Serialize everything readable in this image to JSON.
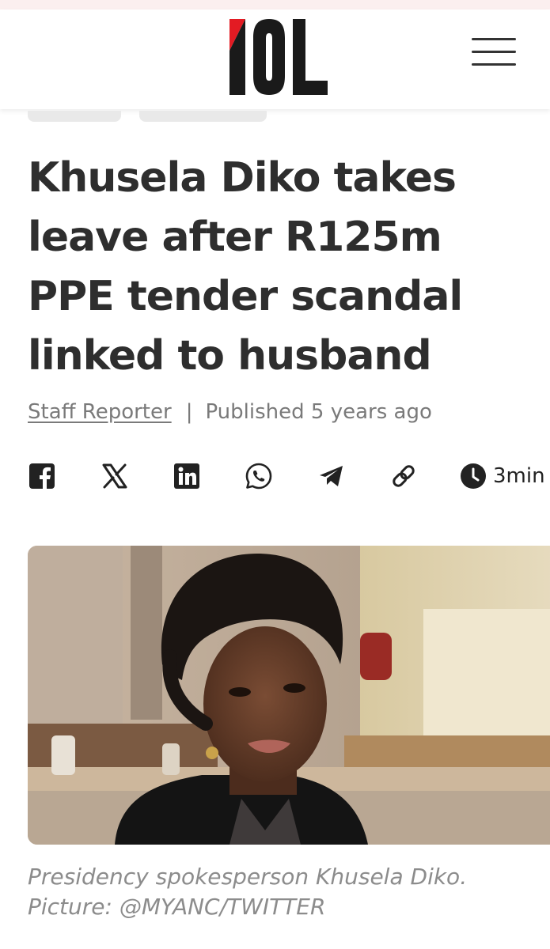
{
  "header": {
    "logo_text": "IOL",
    "menu_icon": "hamburger-menu-icon",
    "brand_colors": {
      "red": "#e31b23",
      "black": "#1a1a1a"
    }
  },
  "article": {
    "headline_lines": [
      "Khusela Diko takes",
      "leave after R125m",
      "PPE tender scandal",
      "linked to husband"
    ],
    "author": "Staff Reporter",
    "separator": "|",
    "published": "Published 5 years ago",
    "read_time": "3min",
    "share_icons": [
      "facebook-icon",
      "x-icon",
      "linkedin-icon",
      "whatsapp-icon",
      "telegram-icon",
      "copy-link-icon"
    ],
    "caption_lines": [
      "Presidency spokesperson Khusela Diko.",
      "Picture: @MYANC/TWITTER"
    ]
  }
}
